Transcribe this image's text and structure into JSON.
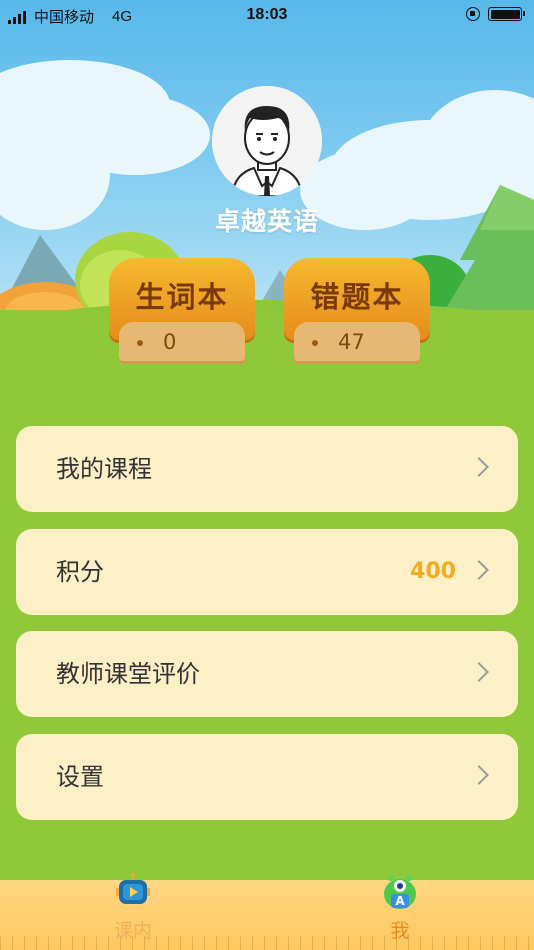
{
  "status_bar": {
    "carrier": "中国移动",
    "network": "4G",
    "time": "18:03"
  },
  "profile": {
    "name": "卓越英语"
  },
  "books": [
    {
      "title": "生词本",
      "count": "0"
    },
    {
      "title": "错题本",
      "count": "47"
    }
  ],
  "menu": [
    {
      "label": "我的课程",
      "value": ""
    },
    {
      "label": "积分",
      "value": "400"
    },
    {
      "label": "教师课堂评价",
      "value": ""
    },
    {
      "label": "设置",
      "value": ""
    }
  ],
  "tabs": [
    {
      "label": "课内",
      "icon": "video-robot-icon",
      "active": false
    },
    {
      "label": "我",
      "icon": "monster-a-icon",
      "active": true
    }
  ],
  "colors": {
    "grass": "#8fc93a",
    "menu_bg": "#fdf0c7",
    "accent_orange": "#f1ac21",
    "tab_active": "#e98a1e",
    "tab_inactive": "#f1b25a"
  }
}
